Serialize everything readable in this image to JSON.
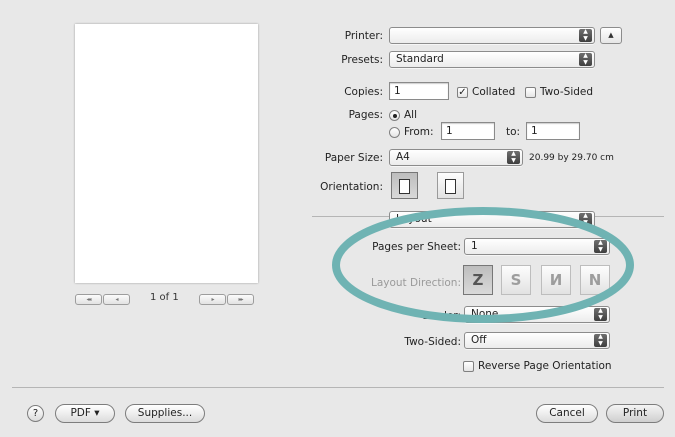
{
  "printer": {
    "label": "Printer:",
    "value": ""
  },
  "presets": {
    "label": "Presets:",
    "value": "Standard"
  },
  "copies": {
    "label": "Copies:",
    "value": "1",
    "collated_label": "Collated",
    "collated_checked": true,
    "two_sided_label": "Two-Sided",
    "two_sided_checked": false
  },
  "pages": {
    "label": "Pages:",
    "all_label": "All",
    "from_label": "From:",
    "from_value": "1",
    "to_label": "to:",
    "to_value": "1",
    "selected": "All"
  },
  "paper_size": {
    "label": "Paper Size:",
    "value": "A4",
    "dimensions": "20.99 by 29.70 cm"
  },
  "orientation": {
    "label": "Orientation:"
  },
  "section_popup": {
    "value": "Layout"
  },
  "layout": {
    "pages_per_sheet_label": "Pages per Sheet:",
    "pages_per_sheet_value": "1",
    "layout_direction_label": "Layout Direction:",
    "direction_glyphs": [
      "Z",
      "S",
      "И",
      "N"
    ],
    "border_label": "Border:",
    "border_value": "None",
    "two_sided_label": "Two-Sided:",
    "two_sided_value": "Off",
    "reverse_label": "Reverse Page Orientation",
    "reverse_checked": false
  },
  "preview": {
    "page_counter": "1 of 1"
  },
  "bottom": {
    "help_label": "?",
    "pdf_label": "PDF ▾",
    "supplies_label": "Supplies...",
    "cancel_label": "Cancel",
    "print_label": "Print"
  },
  "colors": {
    "annotation_ring": "#6fb3b3",
    "window_bg": "#e8e8e8",
    "print_button": "#dcdcdc"
  },
  "icons": {
    "popup_arrows": "updown-arrows-icon",
    "disclosure": "disclosure-triangle-icon",
    "portrait": "portrait-orientation-icon",
    "landscape": "landscape-orientation-icon"
  }
}
